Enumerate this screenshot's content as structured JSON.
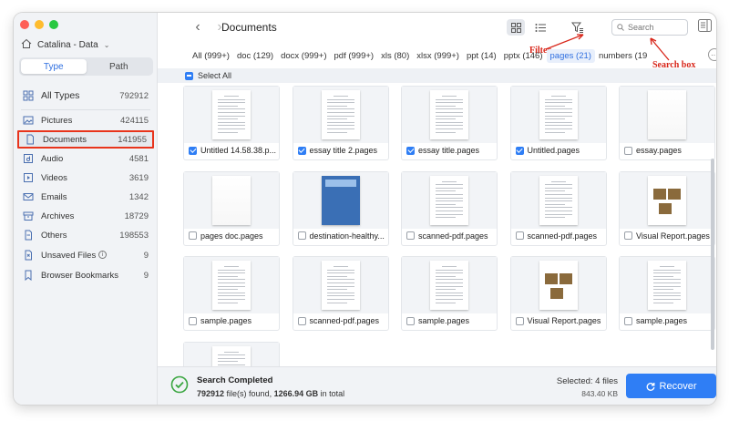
{
  "sidebar": {
    "drive_label": "Catalina - Data",
    "seg_type": "Type",
    "seg_path": "Path",
    "items": [
      {
        "label": "All Types",
        "count": "792912"
      },
      {
        "label": "Pictures",
        "count": "424115"
      },
      {
        "label": "Documents",
        "count": "141955"
      },
      {
        "label": "Audio",
        "count": "4581"
      },
      {
        "label": "Videos",
        "count": "3619"
      },
      {
        "label": "Emails",
        "count": "1342"
      },
      {
        "label": "Archives",
        "count": "18729"
      },
      {
        "label": "Others",
        "count": "198553"
      },
      {
        "label": "Unsaved Files",
        "count": "9"
      },
      {
        "label": "Browser Bookmarks",
        "count": "9"
      }
    ]
  },
  "toolbar": {
    "title": "Documents",
    "search_placeholder": "Search"
  },
  "annotations": {
    "filter": "Filter",
    "search_box": "Search box"
  },
  "tabs": [
    {
      "label": "All (999+)"
    },
    {
      "label": "doc (129)"
    },
    {
      "label": "docx (999+)"
    },
    {
      "label": "pdf (999+)"
    },
    {
      "label": "xls (80)"
    },
    {
      "label": "xlsx (999+)"
    },
    {
      "label": "ppt (14)"
    },
    {
      "label": "pptx (146)"
    },
    {
      "label": "pages (21)"
    },
    {
      "label": "numbers (19"
    }
  ],
  "select_all_label": "Select All",
  "files": [
    {
      "name": "Untitled 14.58.38.p...",
      "checked": true,
      "thumb": "doc"
    },
    {
      "name": "essay title 2.pages",
      "checked": true,
      "thumb": "doc"
    },
    {
      "name": "essay title.pages",
      "checked": true,
      "thumb": "doc"
    },
    {
      "name": "Untitled.pages",
      "checked": true,
      "thumb": "doc"
    },
    {
      "name": "essay.pages",
      "checked": false,
      "thumb": "blank"
    },
    {
      "name": "pages doc.pages",
      "checked": false,
      "thumb": "blank"
    },
    {
      "name": "destination-healthy...",
      "checked": false,
      "thumb": "blue"
    },
    {
      "name": "scanned-pdf.pages",
      "checked": false,
      "thumb": "doc"
    },
    {
      "name": "scanned-pdf.pages",
      "checked": false,
      "thumb": "doc"
    },
    {
      "name": "Visual Report.pages",
      "checked": false,
      "thumb": "photo"
    },
    {
      "name": "sample.pages",
      "checked": false,
      "thumb": "doc"
    },
    {
      "name": "scanned-pdf.pages",
      "checked": false,
      "thumb": "doc"
    },
    {
      "name": "sample.pages",
      "checked": false,
      "thumb": "doc"
    },
    {
      "name": "Visual Report.pages",
      "checked": false,
      "thumb": "photo"
    },
    {
      "name": "sample.pages",
      "checked": false,
      "thumb": "doc"
    },
    {
      "name": "",
      "checked": false,
      "thumb": "doc"
    }
  ],
  "footer": {
    "title": "Search Completed",
    "found_count": "792912",
    "found_text": " file(s) found, ",
    "size_total": "1266.94 GB",
    "size_suffix": " in total",
    "selected": "Selected: 4 files",
    "selected_size": "843.40 KB",
    "recover_label": "Recover"
  },
  "colors": {
    "accent": "#2f7ef5",
    "annotation_red": "#d8261a"
  }
}
